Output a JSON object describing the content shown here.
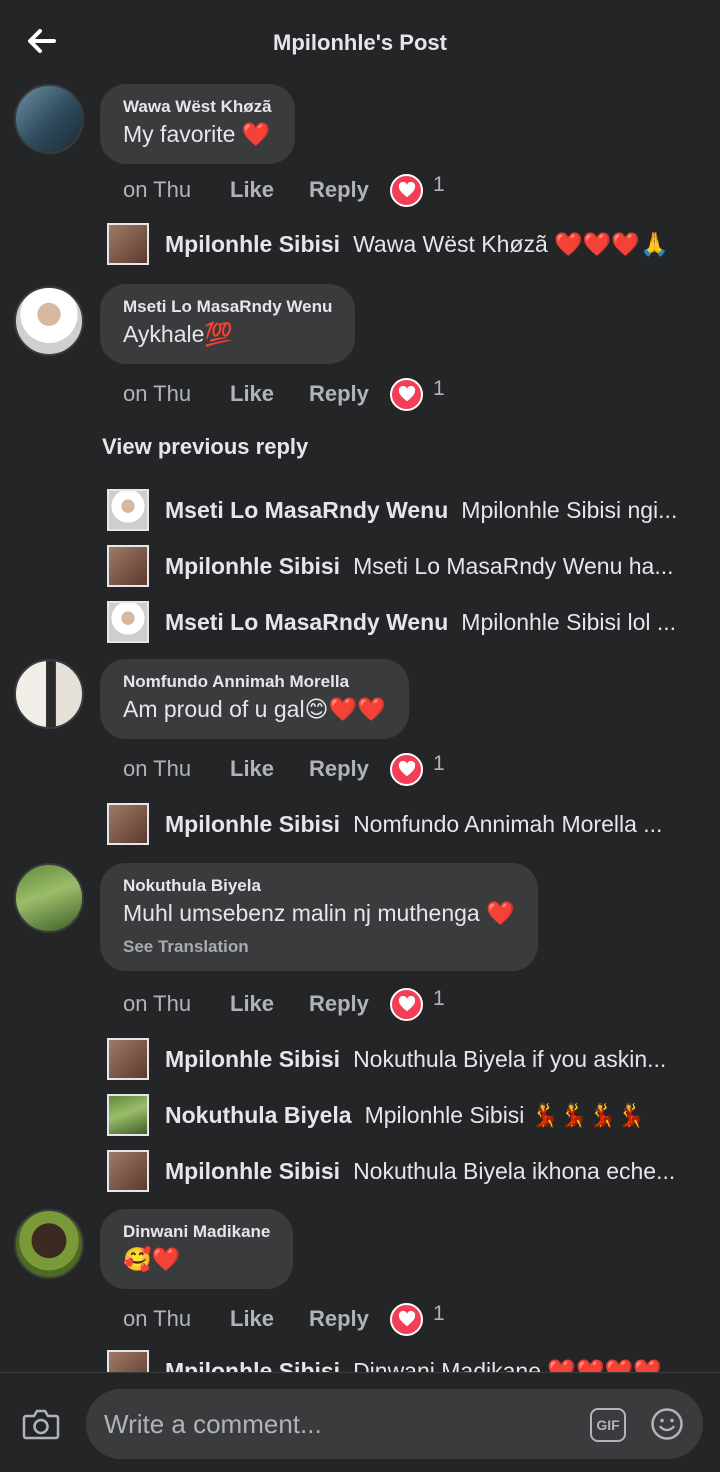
{
  "header": {
    "title": "Mpilonhle's Post",
    "back_icon": "arrow-left-icon"
  },
  "comments": [
    {
      "name": "Wawa Wëst Khøzã",
      "text": "My favorite ❤️",
      "time": "on Thu",
      "like": "Like",
      "reply": "Reply",
      "reaction_count": "1",
      "replies": [
        {
          "name": "Mpilonhle Sibisi",
          "text": "Wawa Wëst Khøzã ❤️❤️❤️🙏"
        }
      ]
    },
    {
      "name": "Mseti Lo MasaRndy Wenu",
      "text": "Aykhale💯",
      "time": "on Thu",
      "like": "Like",
      "reply": "Reply",
      "reaction_count": "1",
      "view_previous": "View previous reply",
      "replies": [
        {
          "name": "Mseti Lo MasaRndy Wenu",
          "text": "Mpilonhle Sibisi ngi..."
        },
        {
          "name": "Mpilonhle Sibisi",
          "text": "Mseti Lo MasaRndy Wenu  ha..."
        },
        {
          "name": "Mseti Lo MasaRndy Wenu",
          "text": "Mpilonhle Sibisi lol ..."
        }
      ]
    },
    {
      "name": "Nomfundo Annimah Morella",
      "text": "Am proud of u gal😊❤️❤️",
      "time": "on Thu",
      "like": "Like",
      "reply": "Reply",
      "reaction_count": "1",
      "replies": [
        {
          "name": "Mpilonhle Sibisi",
          "text": "Nomfundo Annimah Morella ..."
        }
      ]
    },
    {
      "name": "Nokuthula Biyela",
      "text": "Muhl umsebenz malin nj muthenga ❤️",
      "see_translation": "See Translation",
      "time": "on Thu",
      "like": "Like",
      "reply": "Reply",
      "reaction_count": "1",
      "replies": [
        {
          "name": "Mpilonhle Sibisi",
          "text": "Nokuthula Biyela  if you askin..."
        },
        {
          "name": "Nokuthula Biyela",
          "text": "Mpilonhle Sibisi 💃💃💃💃"
        },
        {
          "name": "Mpilonhle Sibisi",
          "text": "Nokuthula Biyela ikhona eche..."
        }
      ]
    },
    {
      "name": "Dinwani Madikane",
      "text": "🥰❤️",
      "time": "on Thu",
      "like": "Like",
      "reply": "Reply",
      "reaction_count": "1",
      "replies": [
        {
          "name": "Mpilonhle Sibisi",
          "text": "Dinwani Madikane ❤️❤️❤️❤️"
        }
      ]
    }
  ],
  "footer": {
    "placeholder": "Write a comment...",
    "gif_label": "GIF",
    "camera_icon": "camera-icon",
    "emoji_icon": "smiley-icon"
  },
  "colors": {
    "background": "#242526",
    "bubble": "#3a3b3c",
    "heart": "#f33e58"
  }
}
